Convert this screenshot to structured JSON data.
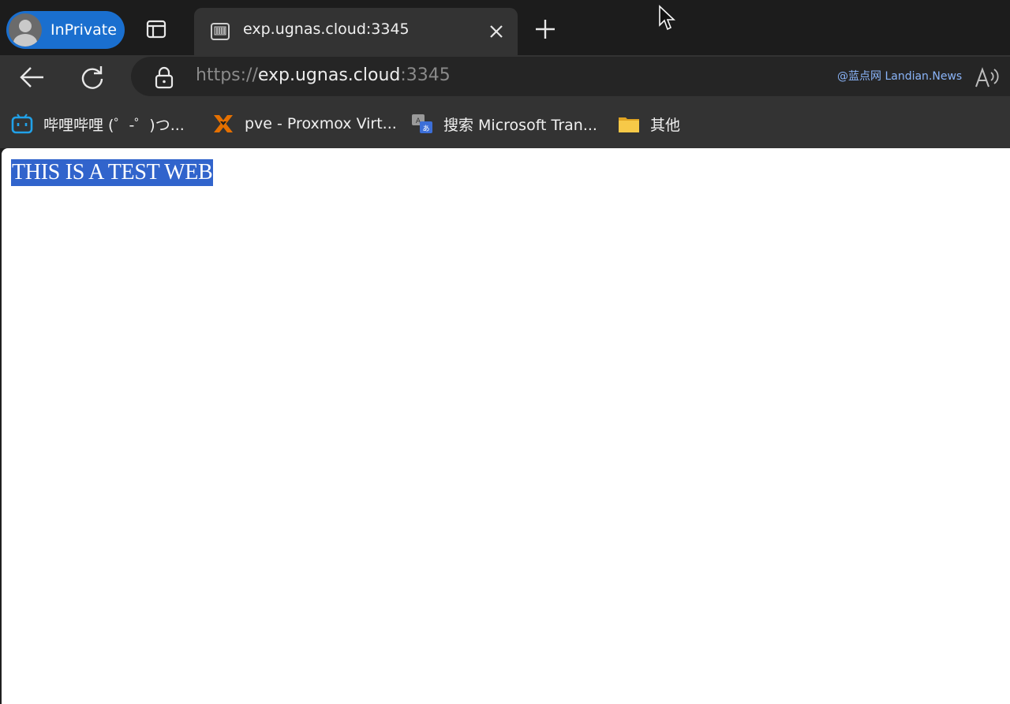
{
  "browser": {
    "profile": {
      "label": "InPrivate",
      "badge_color": "#1a6fcf"
    },
    "tabs": [
      {
        "title": "exp.ugnas.cloud:3345",
        "active": true,
        "favicon": "server-icon"
      }
    ],
    "icons": {
      "workspaces": "workspaces-icon",
      "new_tab": "plus-icon",
      "close_tab": "close-icon",
      "back": "back-arrow-icon",
      "refresh": "refresh-icon",
      "site_info": "lock-icon",
      "read_aloud": "read-aloud-icon"
    },
    "address": {
      "scheme": "https://",
      "host": "exp.ugnas.cloud",
      "port": ":3345"
    },
    "watermark": "@蓝点网 Landian.News",
    "bookmarks": [
      {
        "label": "哔哩哔哩 (゜-゜)つ...",
        "icon": "bilibili-icon"
      },
      {
        "label": "pve - Proxmox Virt...",
        "icon": "proxmox-icon"
      },
      {
        "label": "搜索 Microsoft Tran...",
        "icon": "translator-icon"
      },
      {
        "label": "其他",
        "icon": "folder-icon"
      }
    ]
  },
  "page": {
    "selected_text": "THIS IS A TEST WEB",
    "selection_color": "#3164cc"
  }
}
